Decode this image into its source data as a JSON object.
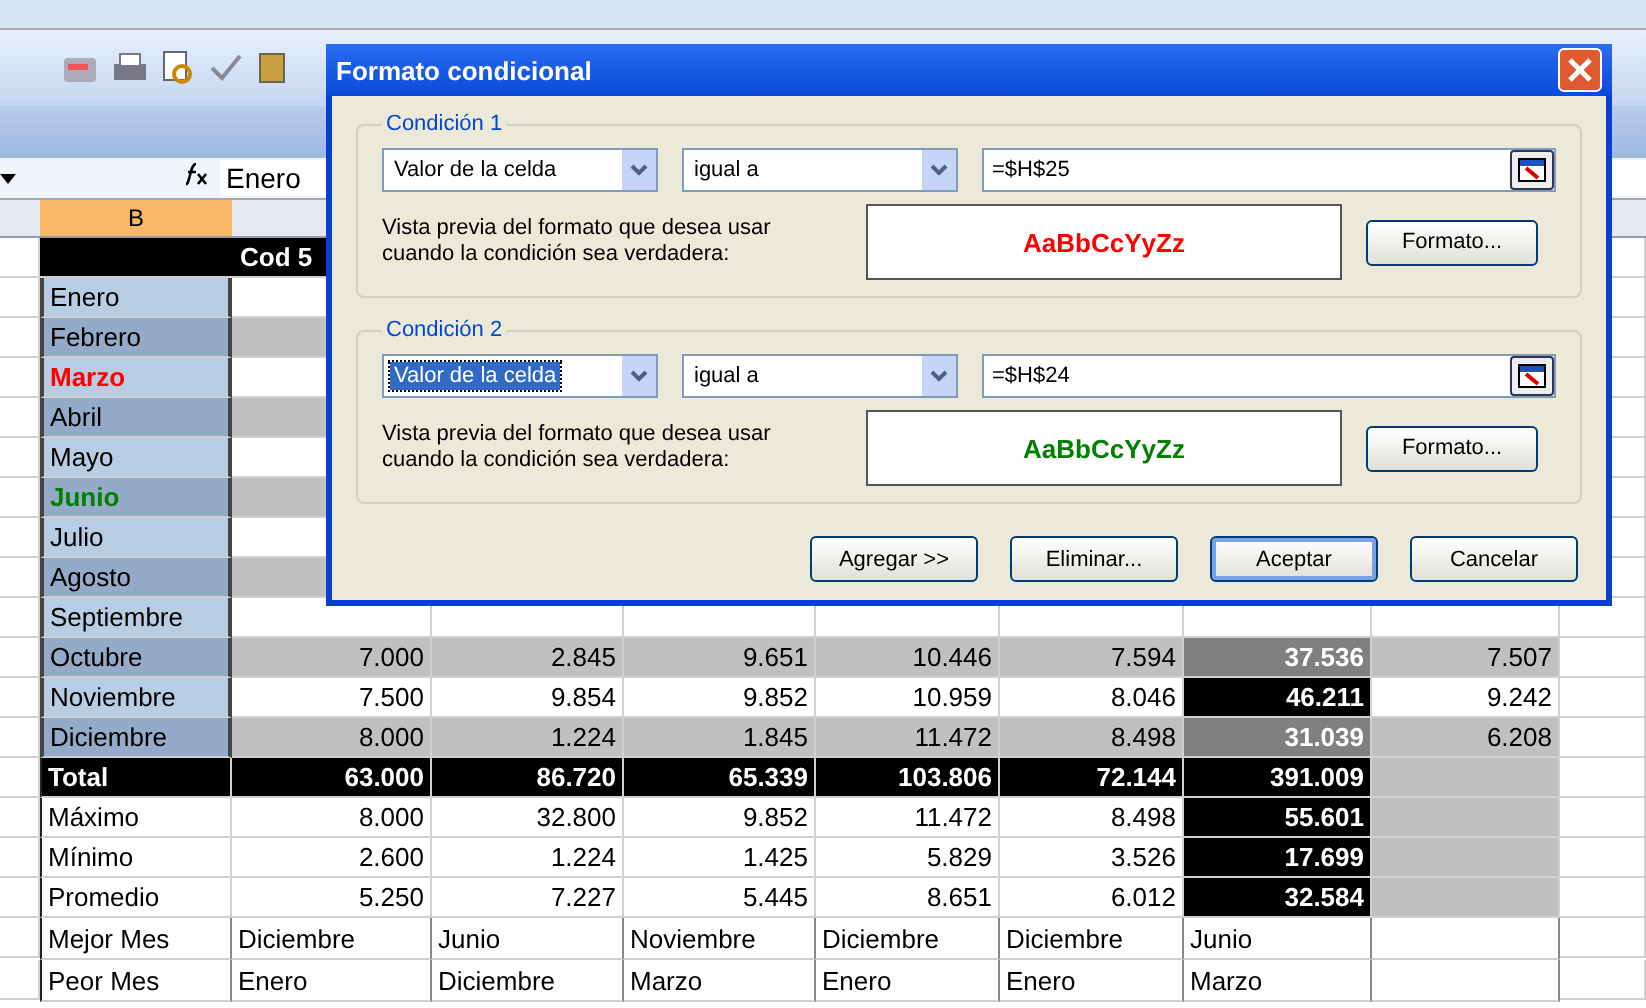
{
  "formula_bar": {
    "value": "Enero"
  },
  "column_headers": [
    {
      "label": "B",
      "selected": true
    }
  ],
  "sheet": {
    "header_text": "Cod 5",
    "rows": [
      {
        "kind": "month",
        "label": "Enero",
        "shaded": false
      },
      {
        "kind": "month",
        "label": "Febrero",
        "shaded": true
      },
      {
        "kind": "month",
        "label": "Marzo",
        "shaded": false,
        "color": "#ff0000"
      },
      {
        "kind": "month",
        "label": "Abril",
        "shaded": true
      },
      {
        "kind": "month",
        "label": "Mayo",
        "shaded": false
      },
      {
        "kind": "month",
        "label": "Junio",
        "shaded": true,
        "color": "#008000"
      },
      {
        "kind": "month",
        "label": "Julio",
        "shaded": false
      },
      {
        "kind": "month",
        "label": "Agosto",
        "shaded": true
      },
      {
        "kind": "month",
        "label": "Septiembre",
        "shaded": false
      },
      {
        "kind": "month",
        "label": "Octubre",
        "shaded": true,
        "cells": [
          "7.000",
          "2.845",
          "9.651",
          "10.446",
          "7.594",
          "37.536",
          "7.507"
        ],
        "total_highlight": false
      },
      {
        "kind": "month",
        "label": "Noviembre",
        "shaded": false,
        "cells": [
          "7.500",
          "9.854",
          "9.852",
          "10.959",
          "8.046",
          "46.211",
          "9.242"
        ],
        "total_highlight": true
      },
      {
        "kind": "month",
        "label": "Diciembre",
        "shaded": true,
        "cells": [
          "8.000",
          "1.224",
          "1.845",
          "11.472",
          "8.498",
          "31.039",
          "6.208"
        ],
        "total_highlight": false
      },
      {
        "kind": "total",
        "label": "Total",
        "cells": [
          "63.000",
          "86.720",
          "65.339",
          "103.806",
          "72.144",
          "391.009"
        ]
      },
      {
        "kind": "stat",
        "label": "Máximo",
        "cells": [
          "8.000",
          "32.800",
          "9.852",
          "11.472",
          "8.498",
          "55.601"
        ]
      },
      {
        "kind": "stat",
        "label": "Mínimo",
        "cells": [
          "2.600",
          "1.224",
          "1.425",
          "5.829",
          "3.526",
          "17.699"
        ]
      },
      {
        "kind": "stat",
        "label": "Promedio",
        "cells": [
          "5.250",
          "7.227",
          "5.445",
          "8.651",
          "6.012",
          "32.584"
        ]
      },
      {
        "kind": "text",
        "label": "Mejor Mes",
        "cells": [
          "Diciembre",
          "Junio",
          "Noviembre",
          "Diciembre",
          "Diciembre",
          "Junio"
        ]
      },
      {
        "kind": "text",
        "label": "Peor Mes",
        "cells": [
          "Enero",
          "Diciembre",
          "Marzo",
          "Enero",
          "Enero",
          "Marzo"
        ]
      }
    ]
  },
  "dialog": {
    "title": "Formato condicional",
    "conditions": [
      {
        "legend": "Condición 1",
        "field": "Valor de la celda",
        "field_focused": false,
        "operator": "igual a",
        "formula": "=$H$25",
        "preview_label": "Vista previa del formato que desea usar cuando la condición sea verdadera:",
        "preview_text": "AaBbCcYyZz",
        "color": "#ff0000",
        "format_button": "Formato..."
      },
      {
        "legend": "Condición 2",
        "field": "Valor de la celda",
        "field_focused": true,
        "operator": "igual a",
        "formula": "=$H$24",
        "preview_label": "Vista previa del formato que desea usar cuando la condición sea verdadera:",
        "preview_text": "AaBbCcYyZz",
        "color": "#008000",
        "format_button": "Formato..."
      }
    ],
    "buttons": [
      {
        "label": "Agregar >>",
        "default": false
      },
      {
        "label": "Eliminar...",
        "default": false
      },
      {
        "label": "Aceptar",
        "default": true
      },
      {
        "label": "Cancelar",
        "default": false
      }
    ]
  }
}
